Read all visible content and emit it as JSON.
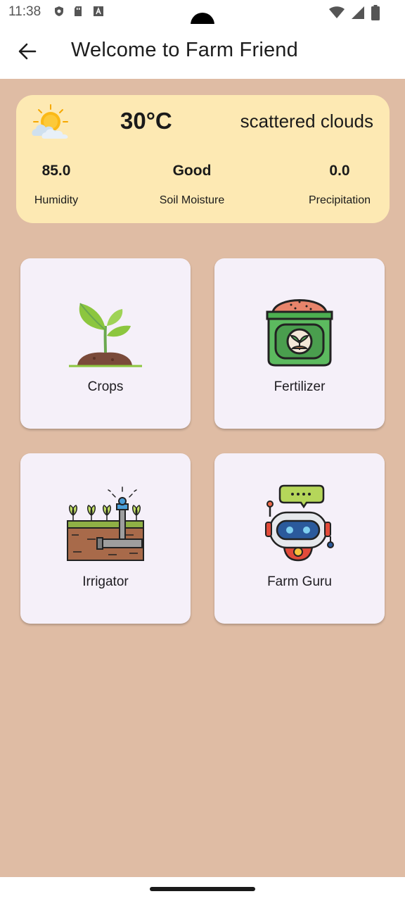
{
  "status": {
    "time": "11:38",
    "left_icons": [
      "shield-icon",
      "sd-card-icon",
      "text-a-icon"
    ],
    "right_icons": [
      "wifi-icon",
      "signal-icon",
      "battery-icon"
    ]
  },
  "appbar": {
    "title": "Welcome to Farm Friend",
    "back_icon": "arrow-back-icon"
  },
  "weather": {
    "icon": "sun-cloud-icon",
    "temperature": "30°C",
    "description": "scattered clouds",
    "stats": [
      {
        "value": "85.0",
        "label": "Humidity"
      },
      {
        "value": "Good",
        "label": "Soil Moisture"
      },
      {
        "value": "0.0",
        "label": "Precipitation"
      }
    ]
  },
  "tiles": [
    {
      "label": "Crops",
      "icon": "sprout-icon"
    },
    {
      "label": "Fertilizer",
      "icon": "fertilizer-bag-icon"
    },
    {
      "label": "Irrigator",
      "icon": "irrigation-sprinkler-icon"
    },
    {
      "label": "Farm Guru",
      "icon": "chatbot-robot-icon"
    }
  ],
  "colors": {
    "background": "#dfbca4",
    "weather_card": "#fde9b3",
    "tile": "#f5f0f9"
  }
}
